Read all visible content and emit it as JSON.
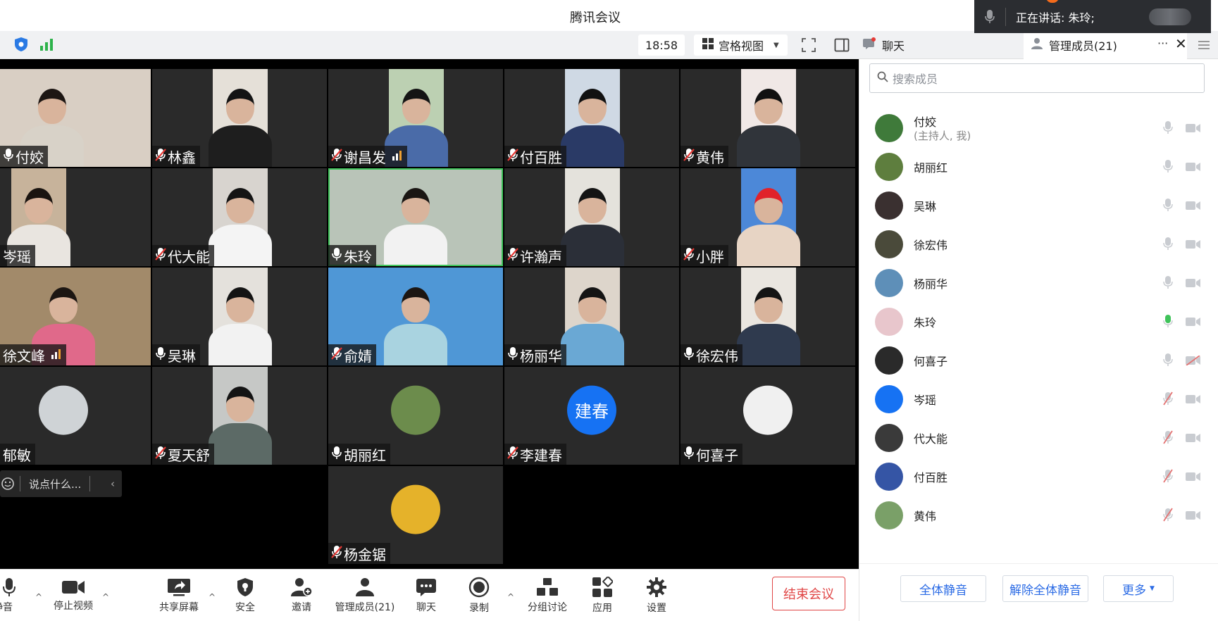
{
  "app": {
    "title": "腾讯会议"
  },
  "speaking": {
    "label": "正在讲话: 朱玲;"
  },
  "topbar": {
    "time": "18:58",
    "view_label": "宫格视图"
  },
  "panel_tabs": {
    "chat": "聊天",
    "members": "管理成员(21)"
  },
  "tiles": [
    {
      "name": "付姣",
      "mic": "on",
      "row": 0,
      "col": 0
    },
    {
      "name": "林鑫",
      "mic": "off",
      "row": 0,
      "col": 1
    },
    {
      "name": "谢昌发",
      "mic": "off",
      "row": 0,
      "col": 2,
      "signal": true
    },
    {
      "name": "付百胜",
      "mic": "off",
      "row": 0,
      "col": 3
    },
    {
      "name": "黄伟",
      "mic": "off",
      "row": 0,
      "col": 4
    },
    {
      "name": "岑瑶",
      "mic": "none",
      "row": 1,
      "col": 0
    },
    {
      "name": "代大能",
      "mic": "off",
      "row": 1,
      "col": 1
    },
    {
      "name": "朱玲",
      "mic": "on",
      "row": 1,
      "col": 2,
      "speaking": true
    },
    {
      "name": "许瀚声",
      "mic": "off",
      "row": 1,
      "col": 3
    },
    {
      "name": "小胖",
      "mic": "off",
      "row": 1,
      "col": 4
    },
    {
      "name": "徐文峰",
      "mic": "none",
      "row": 2,
      "col": 0,
      "signal": true
    },
    {
      "name": "吴琳",
      "mic": "on",
      "row": 2,
      "col": 1
    },
    {
      "name": "俞婧",
      "mic": "off",
      "row": 2,
      "col": 2
    },
    {
      "name": "杨丽华",
      "mic": "on",
      "row": 2,
      "col": 3
    },
    {
      "name": "徐宏伟",
      "mic": "on",
      "row": 2,
      "col": 4
    },
    {
      "name": "郁敏",
      "mic": "none",
      "row": 3,
      "col": 0
    },
    {
      "name": "夏天舒",
      "mic": "off",
      "row": 3,
      "col": 1
    },
    {
      "name": "胡丽红",
      "mic": "on",
      "row": 3,
      "col": 2
    },
    {
      "name": "李建春",
      "mic": "off",
      "row": 3,
      "col": 3,
      "avatar_text": "建春"
    },
    {
      "name": "何喜子",
      "mic": "on",
      "row": 3,
      "col": 4
    },
    {
      "name": "杨金锯",
      "mic": "off",
      "row": 4,
      "col": 2
    }
  ],
  "chat_input": {
    "placeholder": "说点什么..."
  },
  "toolbar": {
    "mute": "静音",
    "stop_video": "停止视频",
    "share_screen": "共享屏幕",
    "security": "安全",
    "invite": "邀请",
    "manage_members": "管理成员(21)",
    "chat": "聊天",
    "record": "录制",
    "breakout": "分组讨论",
    "apps": "应用",
    "settings": "设置",
    "end_meeting": "结束会议"
  },
  "member_panel": {
    "search_placeholder": "搜索成员",
    "members": [
      {
        "name": "付姣",
        "sub": "(主持人, 我)",
        "mic": "on",
        "video": "on"
      },
      {
        "name": "胡丽红",
        "mic": "on",
        "video": "on"
      },
      {
        "name": "吴琳",
        "mic": "on",
        "video": "on"
      },
      {
        "name": "徐宏伟",
        "mic": "on",
        "video": "on"
      },
      {
        "name": "杨丽华",
        "mic": "on",
        "video": "on"
      },
      {
        "name": "朱玲",
        "mic": "talking",
        "video": "on"
      },
      {
        "name": "何喜子",
        "mic": "on",
        "video": "off"
      },
      {
        "name": "岑瑶",
        "mic": "off",
        "video": "on"
      },
      {
        "name": "代大能",
        "mic": "off",
        "video": "on"
      },
      {
        "name": "付百胜",
        "mic": "off",
        "video": "on"
      },
      {
        "name": "黄伟",
        "mic": "off",
        "video": "on"
      }
    ],
    "footer": {
      "mute_all": "全体静音",
      "unmute_all": "解除全体静音",
      "more": "更多"
    }
  }
}
